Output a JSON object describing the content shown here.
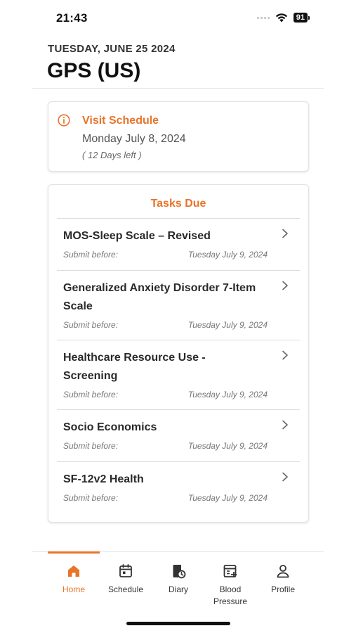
{
  "status_bar": {
    "time": "21:43",
    "battery": "91"
  },
  "header": {
    "date": "TUESDAY, JUNE 25 2024",
    "title": "GPS (US)"
  },
  "visit": {
    "title": "Visit Schedule",
    "date": "Monday July 8, 2024",
    "days_left": "( 12 Days left )"
  },
  "tasks": {
    "title": "Tasks Due",
    "items": [
      {
        "name": "MOS-Sleep Scale – Revised",
        "submit_label": "Submit before:",
        "due": "Tuesday July 9, 2024"
      },
      {
        "name": "Generalized Anxiety Disorder 7-Item Scale",
        "submit_label": "Submit before:",
        "due": "Tuesday July 9, 2024"
      },
      {
        "name": "Healthcare Resource Use -Screening",
        "submit_label": "Submit before:",
        "due": "Tuesday July 9, 2024"
      },
      {
        "name": "Socio Economics",
        "submit_label": "Submit before:",
        "due": "Tuesday July 9, 2024"
      },
      {
        "name": "SF-12v2 Health",
        "submit_label": "Submit before:",
        "due": "Tuesday July 9, 2024"
      }
    ]
  },
  "nav": {
    "items": [
      {
        "label": "Home",
        "icon": "home-icon",
        "active": true
      },
      {
        "label": "Schedule",
        "icon": "calendar-icon",
        "active": false
      },
      {
        "label": "Diary",
        "icon": "diary-icon",
        "active": false
      },
      {
        "label": "Blood Pressure",
        "icon": "blood-pressure-icon",
        "active": false
      },
      {
        "label": "Profile",
        "icon": "profile-icon",
        "active": false
      }
    ]
  },
  "colors": {
    "accent": "#e8742b",
    "text": "#222222",
    "muted": "#777777"
  }
}
